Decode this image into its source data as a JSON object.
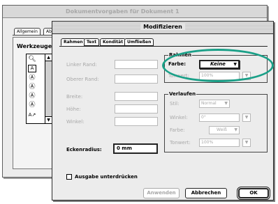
{
  "back_window": {
    "title": "Dokumentvorgaben für Dokument 1",
    "tabs": [
      "Allgemein",
      "Ab"
    ],
    "tools_label": "Werkzeuge:",
    "tool_icons": [
      "magnifier-icon",
      "text-icon",
      "content-icon",
      "item-icon",
      "rotate-icon",
      "link-icon"
    ]
  },
  "dialog": {
    "title": "Modifizieren",
    "tabs": [
      "Rahmen",
      "Text",
      "Kondität",
      "Umfließen"
    ],
    "left": {
      "left_margin_label": "Linker Rand:",
      "top_margin_label": "Oberer Rand:",
      "width_label": "Breite:",
      "height_label": "Höhe:",
      "angle_label": "Winkel:",
      "corner_radius_label": "Eckenradius:",
      "corner_radius_value": "0 mm",
      "suppress_output_label": "Ausgabe unterdrücken"
    },
    "rahmen_group": {
      "title": "Rahmen",
      "color_label": "Farbe:",
      "color_value": "Keine",
      "tone_label": "Tonwert:",
      "tone_value": "100%"
    },
    "gradient_group": {
      "title": "Verlaufen",
      "style_label": "Stil:",
      "style_value": "Normal",
      "angle_label": "Winkel:",
      "angle_value": "0°",
      "color_label": "Farbe:",
      "color_value": "Weiß",
      "tone_label": "Tonwert:",
      "tone_value": "100%"
    },
    "buttons": {
      "apply": "Anwenden",
      "cancel": "Abbrechen",
      "ok": "OK"
    }
  },
  "colors": {
    "highlight": "#1aa088",
    "disabled_text": "#a8a8a8"
  }
}
